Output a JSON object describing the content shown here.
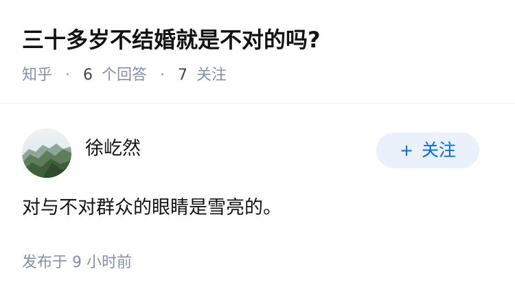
{
  "question": {
    "title": "三十多岁不结婚就是不对的吗?",
    "meta": {
      "source": "知乎",
      "separator": "·",
      "answer_count": "6",
      "answer_label": "个回答",
      "follow_count": "7",
      "follow_label": "关注"
    }
  },
  "answer": {
    "author": {
      "name": "徐屹然",
      "avatar_icon": "mountain-landscape-avatar"
    },
    "follow_button": {
      "icon": "plus-icon",
      "plus": "+",
      "label": "关注"
    },
    "content": "对与不对群众的眼睛是雪亮的。",
    "published": "发布于 9 小时前"
  },
  "colors": {
    "title": "#121212",
    "meta": "#8590a6",
    "accent": "#0066ff",
    "follow_bg": "#ebf1fa",
    "divider": "#ebebeb"
  }
}
